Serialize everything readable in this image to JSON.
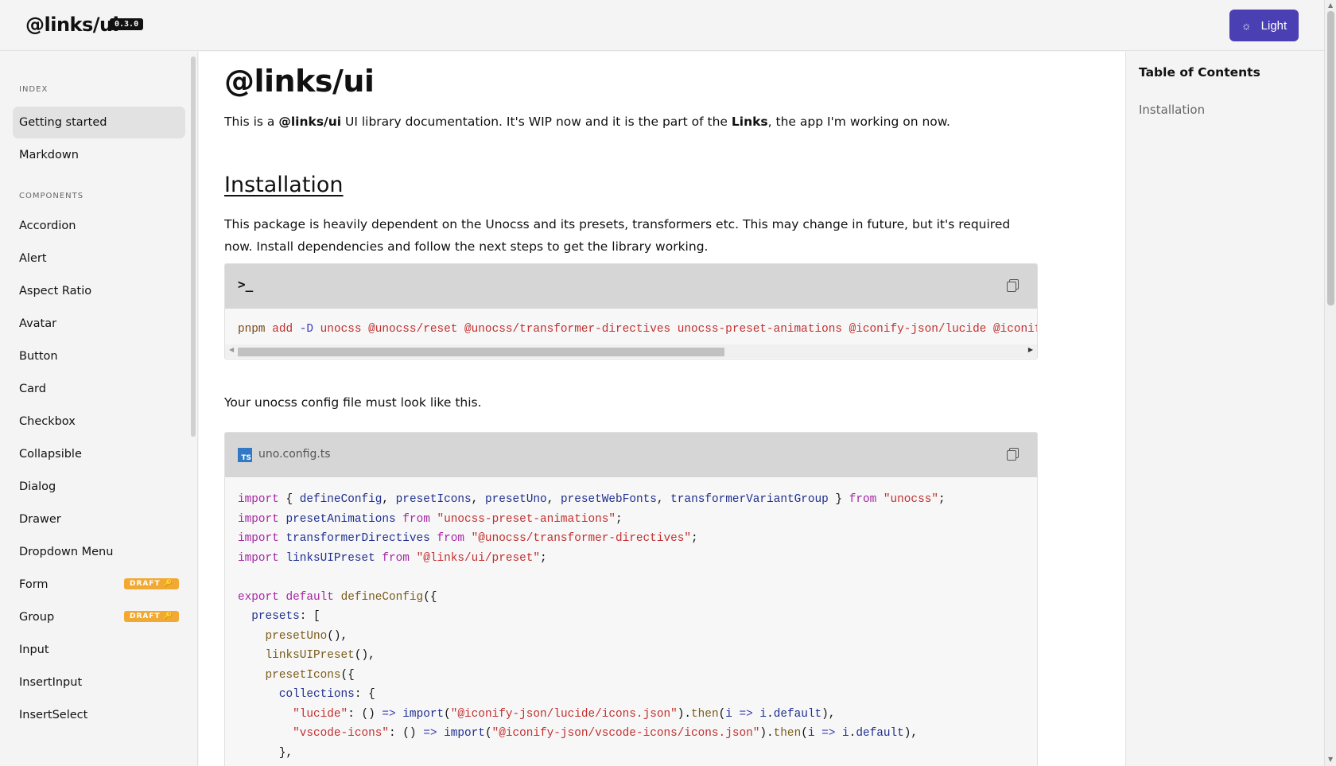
{
  "header": {
    "brand": "@links/ui",
    "version": "0.3.0",
    "theme_label": "Light"
  },
  "sidebar": {
    "sections": [
      {
        "label": "INDEX"
      },
      {
        "label": "COMPONENTS"
      }
    ],
    "index_items": [
      {
        "label": "Getting started",
        "active": true
      },
      {
        "label": "Markdown"
      }
    ],
    "component_items": [
      {
        "label": "Accordion"
      },
      {
        "label": "Alert"
      },
      {
        "label": "Aspect Ratio"
      },
      {
        "label": "Avatar"
      },
      {
        "label": "Button"
      },
      {
        "label": "Card"
      },
      {
        "label": "Checkbox"
      },
      {
        "label": "Collapsible"
      },
      {
        "label": "Dialog"
      },
      {
        "label": "Drawer"
      },
      {
        "label": "Dropdown Menu"
      },
      {
        "label": "Form",
        "badge": "DRAFT 🔑"
      },
      {
        "label": "Group",
        "badge": "DRAFT 🔑"
      },
      {
        "label": "Input"
      },
      {
        "label": "InsertInput"
      },
      {
        "label": "InsertSelect"
      }
    ]
  },
  "main": {
    "title": "@links/ui",
    "intro": {
      "pre": "This is a ",
      "bold1": "@links/ui",
      "mid": " UI library documentation. It's WIP now and it is the part of the ",
      "bold2": "Links",
      "post": ", the app I'm working on now."
    },
    "installation_heading": "Installation",
    "installation_text": "This package is heavily dependent on the Unocss and its presets, transformers etc. This may change in future, but it's required now. Install dependencies and follow the next steps to get the library working.",
    "shell_block": {
      "prompt_icon": "terminal-icon",
      "command": "pnpm add -D unocss @unocss/reset @unocss/transformer-directives unocss-preset-animations @iconify-json/lucide @iconify-j"
    },
    "config_text": "Your unocss config file must look like this.",
    "config_block": {
      "file_badge": "TS",
      "file_name": "uno.config.ts"
    }
  },
  "toc": {
    "title": "Table of Contents",
    "links": [
      "Installation"
    ]
  },
  "colors": {
    "accent": "#4a3fb3",
    "draft_badge": "#f2a933",
    "ts_badge": "#3178c6"
  }
}
